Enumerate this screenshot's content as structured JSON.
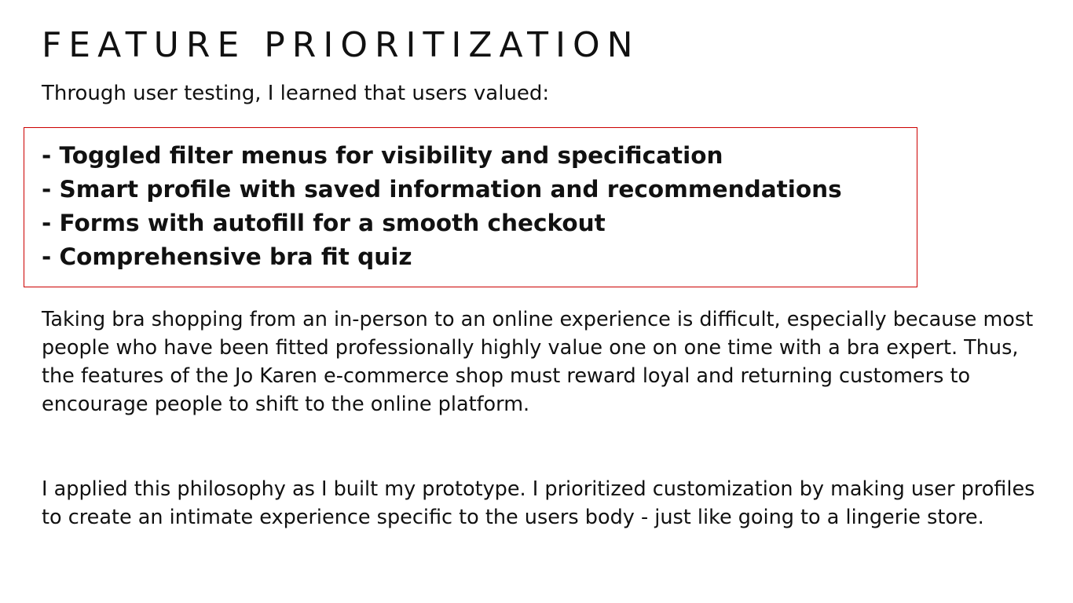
{
  "title": "FEATURE PRIORITIZATION",
  "intro": "Through user testing, I learned that users valued:",
  "features": [
    "- Toggled filter menus for visibility and specification",
    "- Smart profile with saved information and recommendations",
    "- Forms with autofill for a smooth checkout",
    "- Comprehensive bra fit quiz"
  ],
  "paragraphs": [
    "Taking bra shopping from an in-person to an online experience is difficult, especially because most people who have been fitted professionally highly value one on one time with a bra expert. Thus, the features of the Jo Karen e-commerce shop must reward loyal and returning customers to encourage people to shift to the online platform.",
    "I applied this philosophy as I built my prototype. I prioritized customization by making user profiles to create an intimate experience specific to the users body - just like going to a lingerie store."
  ],
  "colors": {
    "text": "#111111",
    "box_border": "#cc0000",
    "background": "#ffffff"
  }
}
